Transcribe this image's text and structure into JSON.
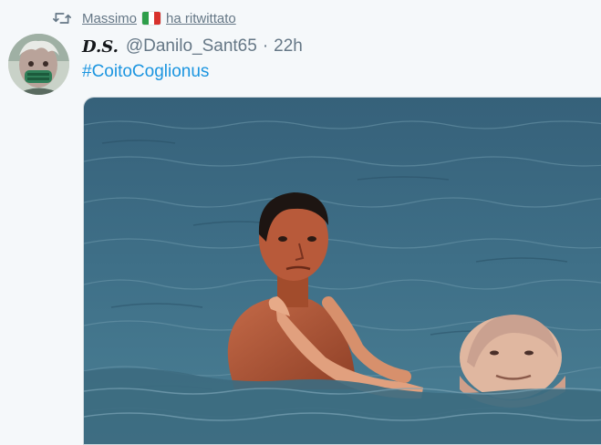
{
  "retweet": {
    "icon": "retweet-icon",
    "user_name": "Massimo",
    "flag_icon": "italian-flag-icon",
    "action_text": "ha ritwittato"
  },
  "tweet": {
    "avatar_icon": "avatar",
    "display_name": "D.S.",
    "handle": "@Danilo_Sant65",
    "separator": "·",
    "time": "22h",
    "text": "#CoitoCoglionus",
    "media_icon": "photo-two-men-swimming-in-sea"
  },
  "colors": {
    "background": "#f5f8fa",
    "link": "#1b95e0",
    "secondary_text": "#657786",
    "primary_text": "#14171a",
    "sea": "#3f6f86"
  }
}
